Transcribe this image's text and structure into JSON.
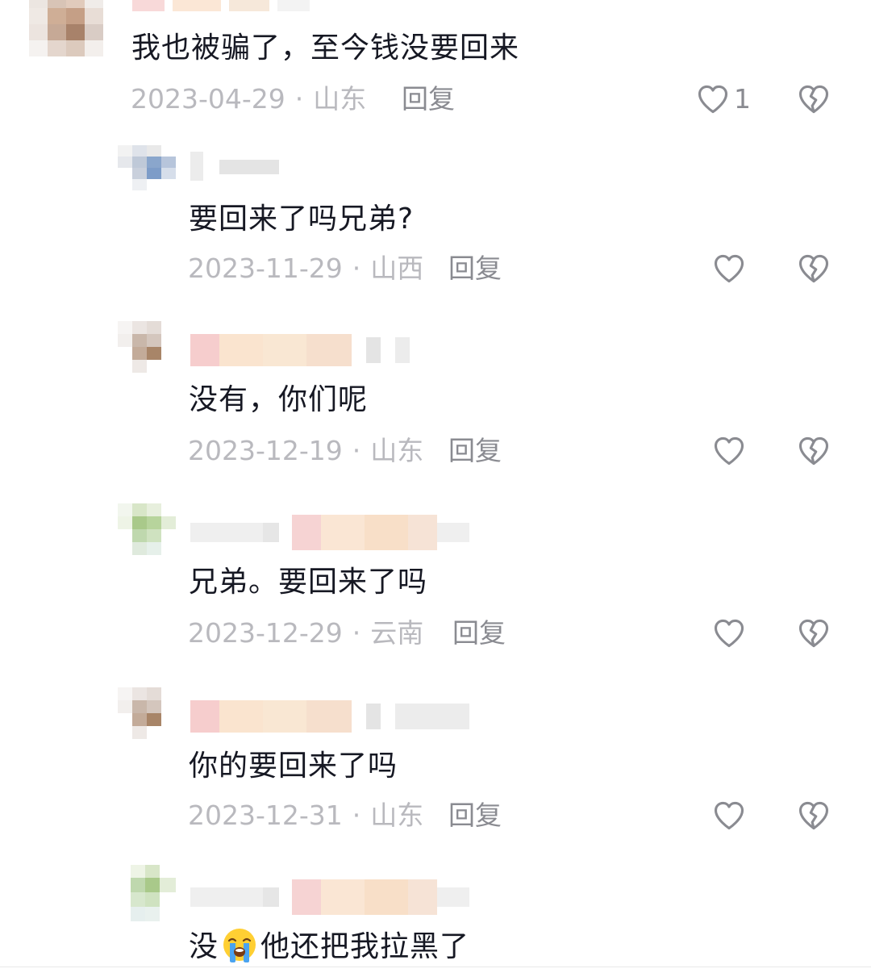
{
  "colors": {
    "text": "#161823",
    "meta": "#b9b9be",
    "reply": "#8a8b91",
    "icon": "#8a8b91"
  },
  "comments": [
    {
      "text": "我也被骗了，至今钱没要回来",
      "date": "2023-04-29",
      "location": "山东",
      "reply_label": "回复",
      "like_count": "1",
      "like_icon": "heart-outline-icon",
      "dislike_icon": "broken-heart-icon"
    },
    {
      "text": "要回来了吗兄弟?",
      "date": "2023-11-29",
      "location": "山西",
      "reply_label": "回复",
      "like_icon": "heart-outline-icon",
      "dislike_icon": "broken-heart-icon"
    },
    {
      "text": "没有，你们呢",
      "date": "2023-12-19",
      "location": "山东",
      "reply_label": "回复",
      "like_icon": "heart-outline-icon",
      "dislike_icon": "broken-heart-icon"
    },
    {
      "text": "兄弟。要回来了吗",
      "date": "2023-12-29",
      "location": "云南",
      "reply_label": "回复",
      "like_icon": "heart-outline-icon",
      "dislike_icon": "broken-heart-icon"
    },
    {
      "text": "你的要回来了吗",
      "date": "2023-12-31",
      "location": "山东",
      "reply_label": "回复",
      "like_icon": "heart-outline-icon",
      "dislike_icon": "broken-heart-icon"
    },
    {
      "text_before_emoji": "没",
      "emoji": "loudly-crying-face-emoji",
      "text_after_emoji": "他还把我拉黑了"
    }
  ],
  "meta_separator": "·"
}
